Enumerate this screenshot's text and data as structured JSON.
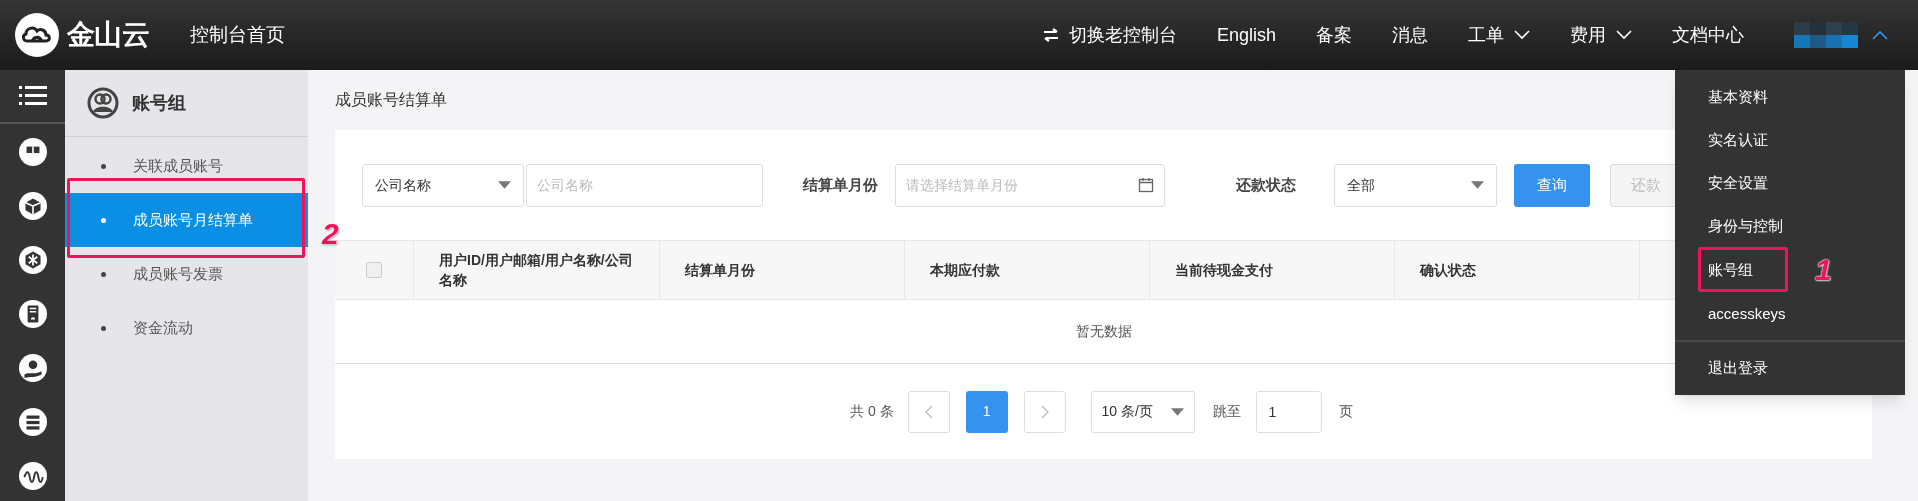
{
  "topbar": {
    "logo_text": "金山云",
    "home": "控制台首页",
    "nav": [
      {
        "label": "切换老控制台",
        "kind": "switch"
      },
      {
        "label": "English",
        "kind": "plain"
      },
      {
        "label": "备案",
        "kind": "plain"
      },
      {
        "label": "消息",
        "kind": "plain"
      },
      {
        "label": "工单",
        "kind": "dropdown"
      },
      {
        "label": "费用",
        "kind": "dropdown"
      },
      {
        "label": "文档中心",
        "kind": "plain"
      }
    ],
    "user_menu_expanded": true
  },
  "sidebar": {
    "title": "账号组",
    "items": [
      {
        "label": "关联成员账号",
        "selected": false
      },
      {
        "label": "成员账号月结算单",
        "selected": true,
        "callout": "2"
      },
      {
        "label": "成员账号发票",
        "selected": false
      },
      {
        "label": "资金流动",
        "selected": false
      }
    ]
  },
  "page_title": "成员账号结算单",
  "filters": {
    "field_select": "公司名称",
    "field_placeholder": "公司名称",
    "month_label": "结算单月份",
    "month_placeholder": "请选择结算单月份",
    "status_label": "还款状态",
    "status_value": "全部",
    "buttons": [
      {
        "label": "查询",
        "disabled": false
      },
      {
        "label": "还款",
        "disabled": true
      }
    ]
  },
  "table": {
    "select_all_checked": false,
    "columns": [
      "用户ID/用户邮箱/用户名称/公司名称",
      "结算单月份",
      "本期应付款",
      "当前待现金支付",
      "确认状态"
    ],
    "empty_text": "暂无数据"
  },
  "pagination": {
    "total": "共 0 条",
    "pages": [
      {
        "label": "1",
        "selected": true
      }
    ],
    "page_size": "10 条/页",
    "jump_label": "跳至",
    "jump_value": "1",
    "page_unit": "页"
  },
  "user_menu": {
    "items": [
      {
        "label": "基本资料",
        "kind": "item"
      },
      {
        "label": "实名认证",
        "kind": "item"
      },
      {
        "label": "安全设置",
        "kind": "item"
      },
      {
        "label": "身份与控制",
        "kind": "item"
      },
      {
        "label": "账号组",
        "kind": "item",
        "callout": "1"
      },
      {
        "label": "accesskeys",
        "kind": "item"
      },
      {
        "label": "退出登录",
        "kind": "logout"
      }
    ]
  }
}
